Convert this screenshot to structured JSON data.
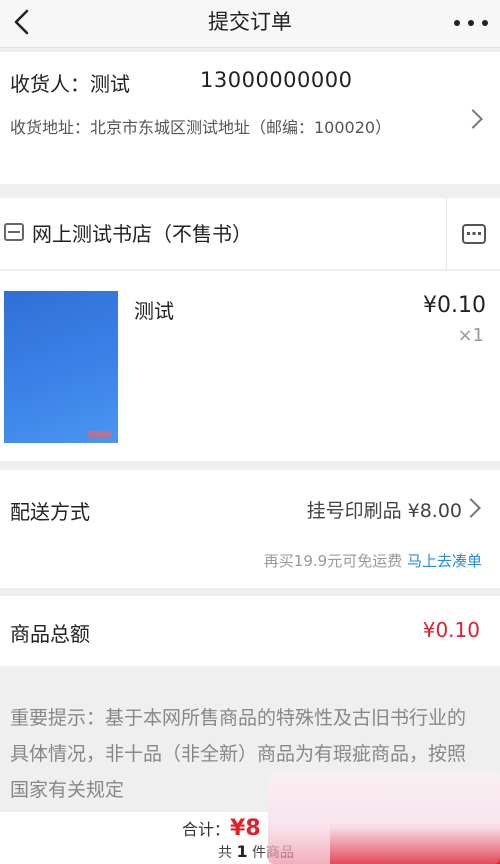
{
  "header": {
    "title": "提交订单"
  },
  "address": {
    "recipient_label": "收货人：",
    "recipient_name": "测试",
    "phone": "13000000000",
    "detail": "收货地址：北京市东城区测试地址（邮编：100020）"
  },
  "store": {
    "name": "网上测试书店（不售书）"
  },
  "product": {
    "name": "测试",
    "price": "¥0.10",
    "quantity": "×1"
  },
  "delivery": {
    "label": "配送方式",
    "value": "挂号印刷品 ¥8.00",
    "free_shipping_note": "再买19.9元可免运费",
    "free_shipping_link": "马上去凑单"
  },
  "total": {
    "label": "商品总额",
    "value": "¥0.10"
  },
  "notice": {
    "text": "重要提示：基于本网所售商品的特殊性及古旧书行业的具体情况，非十品（非全新）商品为有瑕疵商品，按照国家有关规定"
  },
  "bottom_bar": {
    "sum_label": "合计：",
    "sum_value": "¥8",
    "count_prefix": "共",
    "count": "1",
    "count_suffix": "件商品",
    "submit_label": ""
  },
  "colors": {
    "accent_red": "#e0202a",
    "link_blue": "#2a8bd8"
  }
}
